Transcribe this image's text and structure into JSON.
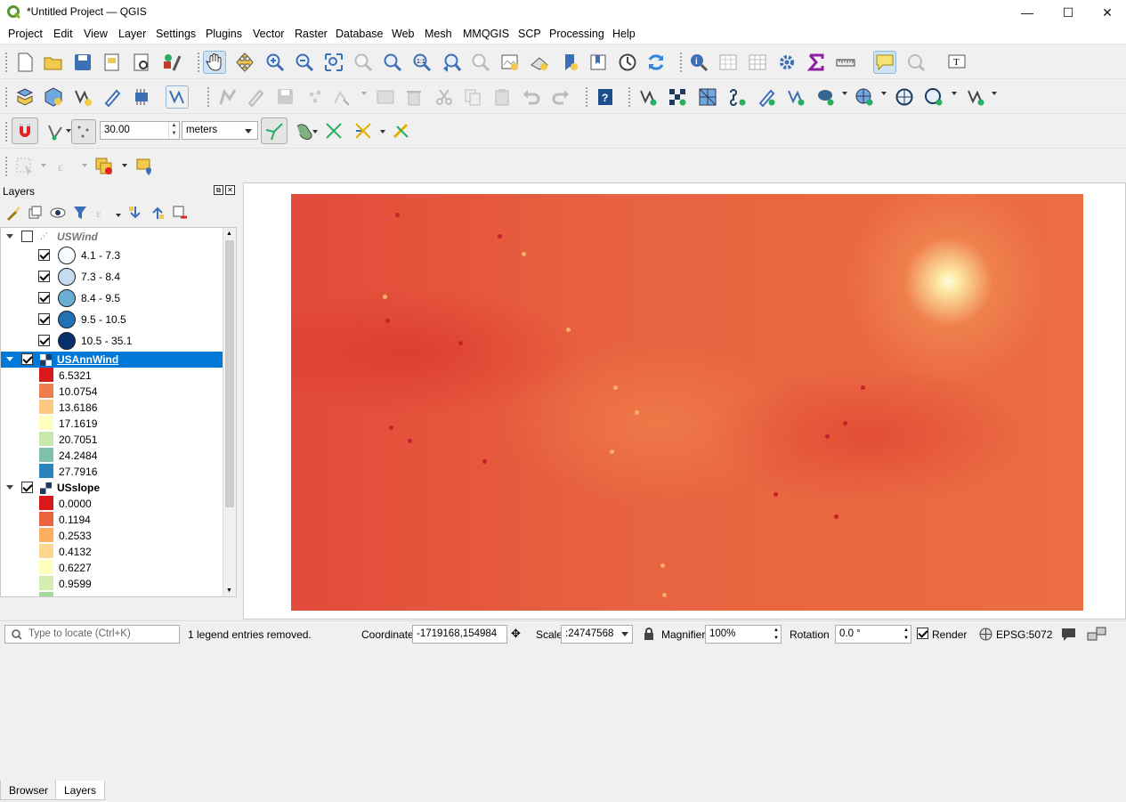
{
  "window": {
    "title": "*Untitled Project — QGIS",
    "minimize": "—",
    "maximize": "☐",
    "close": "✕"
  },
  "menu": [
    "Project",
    "Edit",
    "View",
    "Layer",
    "Settings",
    "Plugins",
    "Vector",
    "Raster",
    "Database",
    "Web",
    "Mesh",
    "MMQGIS",
    "SCP",
    "Processing",
    "Help"
  ],
  "snapping": {
    "tolerance": "30.00",
    "units": "meters"
  },
  "layers_panel": {
    "title": "Layers",
    "layers": [
      {
        "name": "USWind",
        "checked": false,
        "classes": [
          {
            "label": "4.1 - 7.3",
            "color": "#f7fbff"
          },
          {
            "label": "7.3 - 8.4",
            "color": "#c6dbef"
          },
          {
            "label": "8.4 - 9.5",
            "color": "#6baed6"
          },
          {
            "label": "9.5 - 10.5",
            "color": "#2171b5"
          },
          {
            "label": "10.5 - 35.1",
            "color": "#08306b"
          }
        ]
      },
      {
        "name": "USAnnWind",
        "checked": true,
        "classes": [
          {
            "label": "6.5321",
            "color": "#d7191c"
          },
          {
            "label": "10.0754",
            "color": "#ee7e4e"
          },
          {
            "label": "13.6186",
            "color": "#fdc980"
          },
          {
            "label": "17.1619",
            "color": "#ffffbf"
          },
          {
            "label": "20.7051",
            "color": "#c7e8ad"
          },
          {
            "label": "24.2484",
            "color": "#80bfab"
          },
          {
            "label": "27.7916",
            "color": "#2b83ba"
          }
        ]
      },
      {
        "name": "USslope",
        "checked": true,
        "classes": [
          {
            "label": "0.0000",
            "color": "#d7191c"
          },
          {
            "label": "0.1194",
            "color": "#ea633e"
          },
          {
            "label": "0.2533",
            "color": "#fdae61"
          },
          {
            "label": "0.4132",
            "color": "#fed690"
          },
          {
            "label": "0.6227",
            "color": "#ffffbf"
          },
          {
            "label": "0.9599",
            "color": "#d4edb0"
          }
        ]
      }
    ]
  },
  "tabs": [
    "Browser",
    "Layers"
  ],
  "status": {
    "locate_placeholder": "Type to locate (Ctrl+K)",
    "message": "1 legend entries removed.",
    "coordinate_label": "Coordinate",
    "coordinate": "-1719168,154984",
    "scale_label": "Scale",
    "scale": ":24747568",
    "magnifier_label": "Magnifier",
    "magnifier": "100%",
    "rotation_label": "Rotation",
    "rotation": "0.0 °",
    "render_label": "Render",
    "crs": "EPSG:5072"
  }
}
